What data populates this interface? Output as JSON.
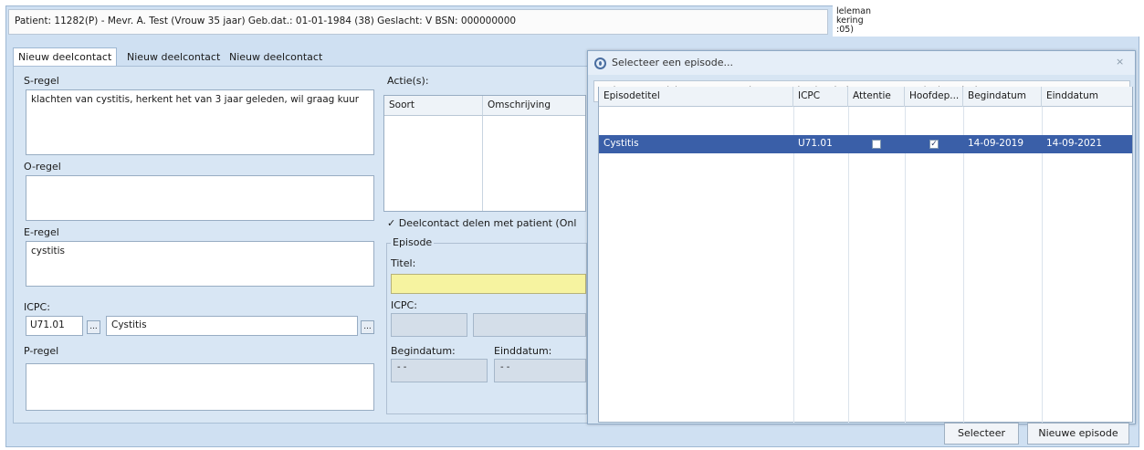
{
  "patient_bar": "Patient: 11282(P) - Mevr. A. Test (Vrouw 35 jaar) Geb.dat.: 01-01-1984 (38) Geslacht: V BSN: 000000000",
  "side_note": [
    "leleman",
    "kering",
    ":05)"
  ],
  "tabs": [
    "Nieuw deelcontact",
    "Nieuw deelcontact",
    "Nieuw deelcontact"
  ],
  "form": {
    "s_label": "S-regel",
    "s_value": "klachten van cystitis, herkent het van 3 jaar geleden, wil graag kuur",
    "o_label": "O-regel",
    "o_value": "",
    "e_label": "E-regel",
    "e_value": "cystitis",
    "icpc_label": "ICPC:",
    "icpc_code": "U71.01",
    "icpc_desc": "Cystitis",
    "ellipsis": "...",
    "p_label": "P-regel",
    "p_value": ""
  },
  "actions": {
    "label": "Actie(s):",
    "col_soort": "Soort",
    "col_omschrijving": "Omschrijving",
    "share_label": "Deelcontact delen met patient (Onl",
    "share_checked": true
  },
  "episode": {
    "legend": "Episode",
    "title_label": "Titel:",
    "icpc_label": "ICPC:",
    "start_label": "Begindatum:",
    "end_label": "Einddatum:",
    "start_value": "- -",
    "end_value": "- -"
  },
  "dialog": {
    "title": "Selecteer een episode...",
    "patient_bar": "Patient: 11282(P) - Mevr. A. Test (Vrouw 35 jaar) Geb.dat.: 01-01-1984 (38) Geslacht: V BSN: 000000000",
    "columns": [
      "Episodetitel",
      "ICPC",
      "Attentie",
      "Hoofdep...",
      "Begindatum",
      "Einddatum"
    ],
    "rows": [
      {
        "titel": "Cystitis",
        "icpc": "U71.01",
        "attentie": false,
        "hoofdep": true,
        "begindatum": "14-09-2019",
        "einddatum": "14-09-2021"
      }
    ],
    "select_button": "Selecteer",
    "new_button": "Nieuwe episode"
  },
  "colors": {
    "selected_row": "#3a5fa8",
    "panel_bg": "#d8e6f4",
    "highlight_field": "#f6f3a0"
  }
}
